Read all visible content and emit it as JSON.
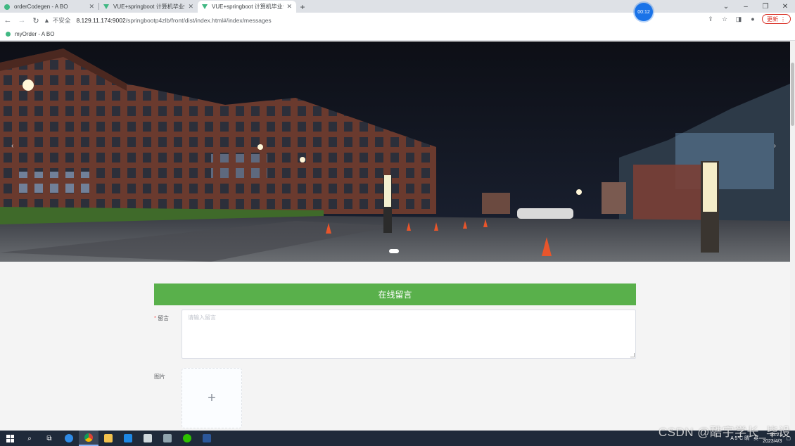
{
  "browser": {
    "tabs": [
      {
        "title": "orderCodegen - A BO",
        "icon": "green-dot-icon"
      },
      {
        "title": "VUE+springboot 计算机毕业设计",
        "icon": "vue-icon"
      },
      {
        "title": "VUE+springboot 计算机毕业设计",
        "icon": "vue-icon"
      }
    ],
    "new_tab": "+",
    "timer_badge": "00:12",
    "window_controls": {
      "minimize": "–",
      "restore": "❐",
      "close": "✕",
      "chevron": "⌄"
    },
    "security_label": "不安全",
    "url_host": "8.129.11.174:9002",
    "url_path": "/springbootp4zlb/front/dist/index.html#/index/messages",
    "update_label": "更新",
    "bookmark": "myOrder - A BO"
  },
  "banner": {
    "prev_arrow": "‹",
    "next_arrow": "›",
    "slides": 1
  },
  "form": {
    "header": "在线留言",
    "message_label": "留言",
    "required_mark": "*",
    "message_placeholder": "请输入留言",
    "image_label": "图片",
    "upload_plus": "+"
  },
  "taskbar": {
    "lang": "英",
    "tray_text": "A 5°C 晴",
    "time": "16:21",
    "date": "2023/4/3"
  },
  "watermark": "CSDN @酷宇学长_毕设"
}
